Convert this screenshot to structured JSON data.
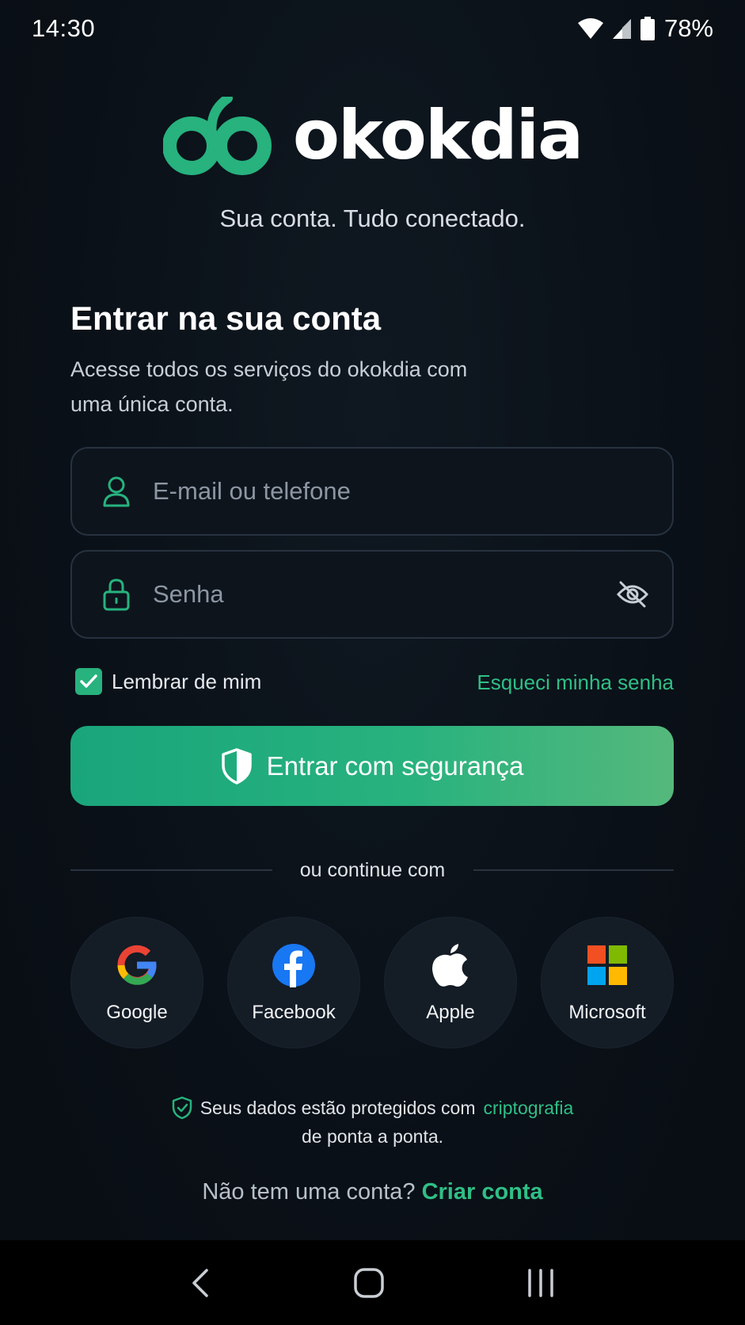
{
  "status_bar": {
    "time": "14:30",
    "battery": "78%"
  },
  "brand": {
    "name": "okokdia",
    "tagline": "Sua conta. Tudo conectado.",
    "accent_color": "#27b27e"
  },
  "form": {
    "title": "Entrar na sua conta",
    "subtitle": "Acesse todos os serviços do okokdia com uma única conta.",
    "email_placeholder": "E-mail ou telefone",
    "password_placeholder": "Senha",
    "remember_label": "Lembrar de mim",
    "remember_checked": true,
    "forgot_label": "Esqueci minha senha",
    "submit_label": "Entrar com segurança"
  },
  "social": {
    "divider_label": "ou continue com",
    "providers": [
      {
        "label": "Google",
        "icon": "google-icon"
      },
      {
        "label": "Facebook",
        "icon": "facebook-icon"
      },
      {
        "label": "Apple",
        "icon": "apple-icon"
      },
      {
        "label": "Microsoft",
        "icon": "microsoft-icon"
      }
    ]
  },
  "security_note": {
    "prefix": "Seus dados estão protegidos com",
    "highlight": "criptografia",
    "suffix": "de ponta a ponta."
  },
  "signup": {
    "prompt": "Não tem uma conta?",
    "link": "Criar conta"
  }
}
